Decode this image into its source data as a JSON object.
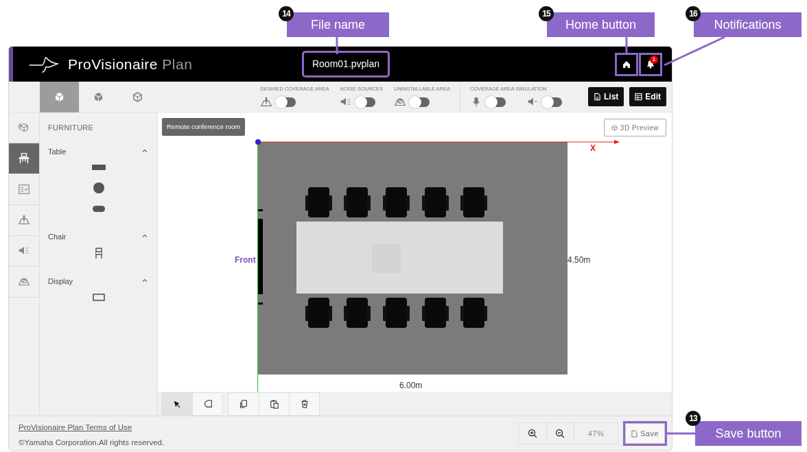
{
  "callouts": [
    {
      "number": "14",
      "label": "File name"
    },
    {
      "number": "15",
      "label": "Home button"
    },
    {
      "number": "16",
      "label": "Notifications"
    },
    {
      "number": "13",
      "label": "Save button"
    }
  ],
  "header": {
    "app_name": "ProVisionaire",
    "app_name_suffix": "Plan",
    "file_name": "Room01.pvplan",
    "notification_count": "1"
  },
  "view_tabs": [
    {
      "selected": true
    },
    {
      "selected": false
    },
    {
      "selected": false
    }
  ],
  "toggle_groups": [
    {
      "label": "DESIRED COVERAGE AREA",
      "toggles": [
        {
          "kind": "coverage",
          "on": false
        }
      ]
    },
    {
      "label": "NOISE SOURCES",
      "toggles": [
        {
          "kind": "noise",
          "on": false
        }
      ]
    },
    {
      "label": "UNINSTALLABLE AREA",
      "toggles": [
        {
          "kind": "uninstallable",
          "on": false
        }
      ]
    },
    {
      "label": "COVERAGE AREA SIMULATION",
      "toggles": [
        {
          "kind": "mic",
          "on": false
        },
        {
          "kind": "speaker",
          "on": false
        }
      ]
    }
  ],
  "action_buttons": [
    {
      "kind": "list",
      "label": "List"
    },
    {
      "kind": "edit",
      "label": "Edit"
    }
  ],
  "rail": [
    {
      "kind": "room",
      "selected": false
    },
    {
      "kind": "furniture",
      "selected": true
    },
    {
      "kind": "checklist",
      "selected": false
    },
    {
      "kind": "coverage",
      "selected": false
    },
    {
      "kind": "noise",
      "selected": false
    },
    {
      "kind": "uninstallable",
      "selected": false
    }
  ],
  "furniture": {
    "title": "FURNITURE",
    "sections": [
      {
        "label": "Table",
        "expanded": true,
        "items": [
          {
            "kind": "rect"
          },
          {
            "kind": "circle"
          },
          {
            "kind": "pill"
          }
        ]
      },
      {
        "label": "Chair",
        "expanded": true,
        "items": [
          {
            "kind": "chair"
          }
        ]
      },
      {
        "label": "Display",
        "expanded": true,
        "items": [
          {
            "kind": "display"
          }
        ]
      }
    ]
  },
  "canvas": {
    "room_name": "Remote conference room",
    "preview_button": "3D Preview",
    "axis_label": "X",
    "front_label": "Front",
    "depth_label": "4.50m",
    "width_label": "6.00m"
  },
  "tool_groups": [
    [
      {
        "kind": "select",
        "selected": true
      },
      {
        "kind": "area",
        "selected": false
      }
    ],
    [
      {
        "kind": "copy",
        "selected": false
      },
      {
        "kind": "paste",
        "selected": false
      },
      {
        "kind": "delete",
        "selected": false
      }
    ]
  ],
  "footer": {
    "terms_link": "ProVisionaire Plan Terms of Use",
    "copyright": "©Yamaha Corporation.All rights reserved.",
    "zoom_level": "47%",
    "save_button": "Save"
  }
}
